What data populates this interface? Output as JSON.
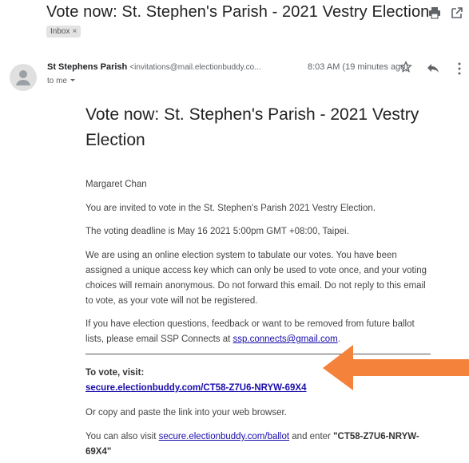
{
  "email": {
    "subject": "Vote now: St. Stephen's Parish - 2021 Vestry Election",
    "label_chip": "Inbox",
    "label_chip_close": "×",
    "sender_name": "St Stephens Parish",
    "sender_email": "<invitations@mail.electionbuddy.co...",
    "time": "8:03 AM (19 minutes ago)",
    "to": "to me"
  },
  "body": {
    "heading": "Vote now: St. Stephen's Parish - 2021 Vestry Election",
    "greeting": "Margaret Chan",
    "invite": "You are invited to vote in the St. Stephen's Parish 2021 Vestry Election.",
    "deadline": "The voting deadline is May 16 2021 5:00pm GMT +08:00, Taipei.",
    "info": "We are using an online election system to tabulate our votes. You have been assigned a unique access key which can only be used to vote once, and your voting choices will remain anonymous. Do not forward this email. Do not reply to this email to vote, as your vote will not be registered.",
    "questions_prefix": "If you have election questions, feedback or want to be removed from future ballot lists, please email SSP Connects at ",
    "questions_email": "ssp.connects@gmail.com",
    "questions_suffix": ".",
    "to_vote_label": "To vote, visit:",
    "vote_link": "secure.electionbuddy.com/CT58-Z7U6-NRYW-69X4",
    "copy_paste": "Or copy and paste the link into your web browser.",
    "also_prefix": "You can also visit ",
    "ballot_link": "secure.electionbuddy.com/ballot",
    "also_middle": " and enter ",
    "access_key": "\"CT58-Z7U6-NRYW-69X4\""
  },
  "colors": {
    "arrow": "#f4823a",
    "link": "#1a0dab"
  },
  "icons": [
    "print-icon",
    "open-new-window-icon",
    "avatar-icon",
    "star-icon",
    "reply-icon",
    "more-vertical-icon",
    "chevron-down-icon",
    "orange-arrow-annotation"
  ]
}
